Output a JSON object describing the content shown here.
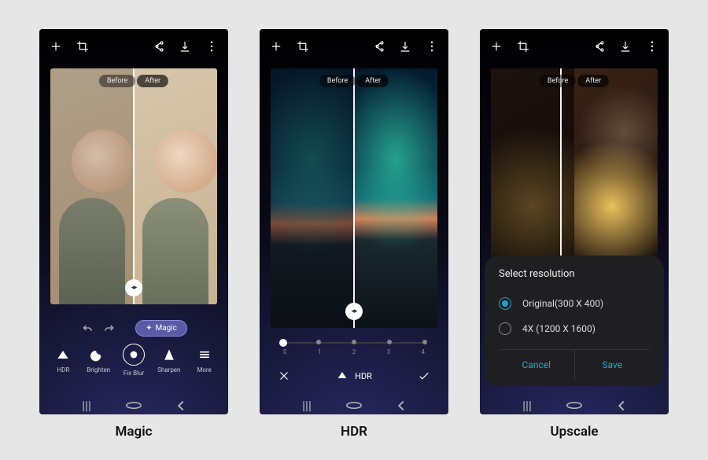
{
  "captions": {
    "magic": "Magic",
    "hdr": "HDR",
    "upscale": "Upscale"
  },
  "compare": {
    "before": "Before",
    "after": "After"
  },
  "magic": {
    "pill": "Magic",
    "tools": [
      {
        "name": "hdr",
        "label": "HDR"
      },
      {
        "name": "brighten",
        "label": "Brighten"
      },
      {
        "name": "fixblur",
        "label": "Fix Blur"
      },
      {
        "name": "sharpen",
        "label": "Sharpen"
      },
      {
        "name": "more",
        "label": "More"
      }
    ]
  },
  "hdr": {
    "label": "HDR",
    "slider": {
      "values": [
        "0",
        "1",
        "2",
        "3",
        "4"
      ],
      "selected_index": 0
    }
  },
  "upscale": {
    "sheet_title": "Select resolution",
    "options": [
      {
        "label": "Original(300 X 400)",
        "selected": true
      },
      {
        "label": "4X (1200 X 1600)",
        "selected": false
      }
    ],
    "cancel": "Cancel",
    "save": "Save"
  }
}
